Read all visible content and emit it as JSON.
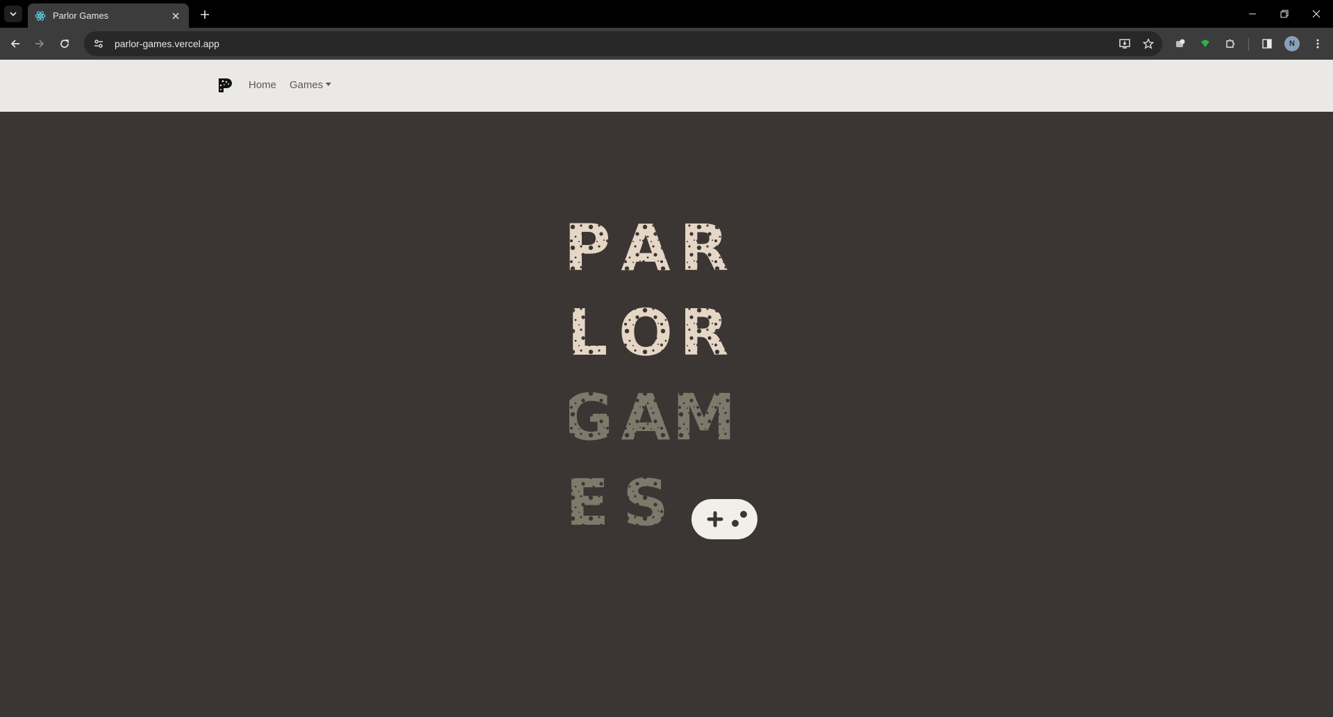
{
  "browser": {
    "tab_title": "Parlor Games",
    "url": "parlor-games.vercel.app",
    "avatar_initial": "N"
  },
  "nav": {
    "home_label": "Home",
    "games_label": "Games"
  },
  "hero": {
    "lines": [
      {
        "letters": [
          "P",
          "A",
          "R"
        ],
        "color": "#e6d6c6"
      },
      {
        "letters": [
          "L",
          "O",
          "R"
        ],
        "color": "#e6d6c6"
      },
      {
        "letters": [
          "G",
          "A",
          "M"
        ],
        "color": "#7f796c"
      },
      {
        "letters": [
          "E",
          "S"
        ],
        "color": "#7f796c"
      }
    ],
    "controller_icon": "gamepad-icon",
    "background": "#3b3633",
    "navbar_bg": "#ebe9e6"
  }
}
